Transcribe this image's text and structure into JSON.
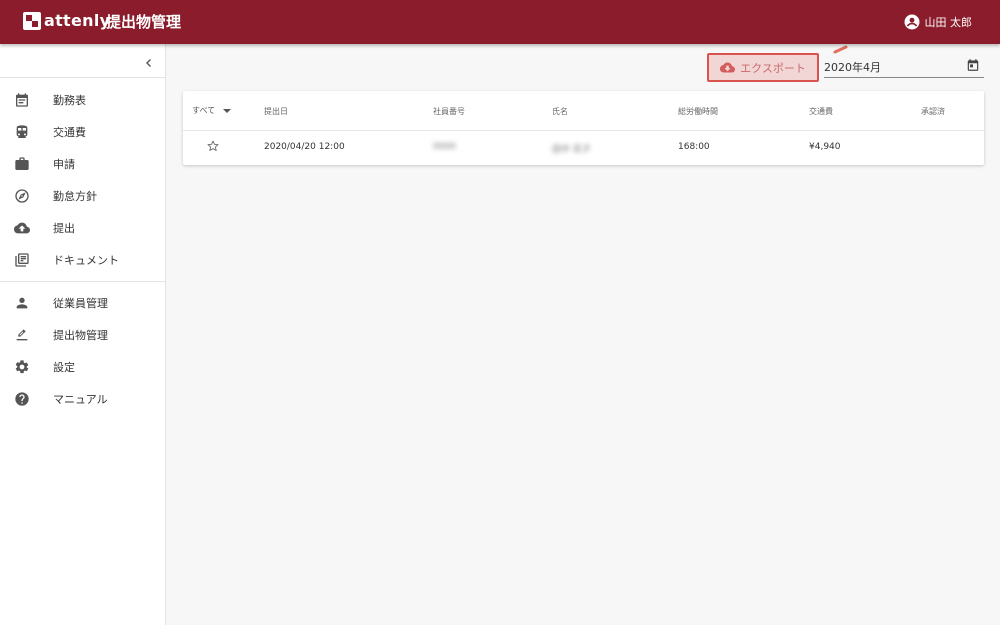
{
  "header": {
    "logo_text": "attenly",
    "title": "提出物管理",
    "user_name": "山田 太郎"
  },
  "sidebar": {
    "collapse_icon": "chevron-left-icon",
    "group1": [
      {
        "label": "勤務表",
        "icon": "calendar-icon"
      },
      {
        "label": "交通費",
        "icon": "train-icon"
      },
      {
        "label": "申請",
        "icon": "briefcase-icon"
      },
      {
        "label": "勤怠方針",
        "icon": "compass-icon"
      },
      {
        "label": "提出",
        "icon": "cloud-upload-icon"
      },
      {
        "label": "ドキュメント",
        "icon": "library-icon"
      }
    ],
    "group2": [
      {
        "label": "従業員管理",
        "icon": "person-icon"
      },
      {
        "label": "提出物管理",
        "icon": "stamp-icon"
      },
      {
        "label": "設定",
        "icon": "gear-icon"
      },
      {
        "label": "マニュアル",
        "icon": "help-circle-icon"
      }
    ]
  },
  "toolbar": {
    "export_label": "エクスポート",
    "month_value": "2020年4月"
  },
  "table": {
    "filter_label": "すべて",
    "columns": [
      "提出日",
      "社員番号",
      "氏名",
      "総労働時間",
      "交通費",
      "承認済"
    ],
    "rows": [
      {
        "submitted": "2020/04/20 12:00",
        "employee_no": "0000",
        "name": "田中 花子",
        "total_hours": "168:00",
        "transport": "¥4,940",
        "approved": ""
      }
    ]
  },
  "colors": {
    "header_bg": "#8a1c2b",
    "export_border": "#d9534f",
    "export_bg": "#f2d6d6"
  }
}
